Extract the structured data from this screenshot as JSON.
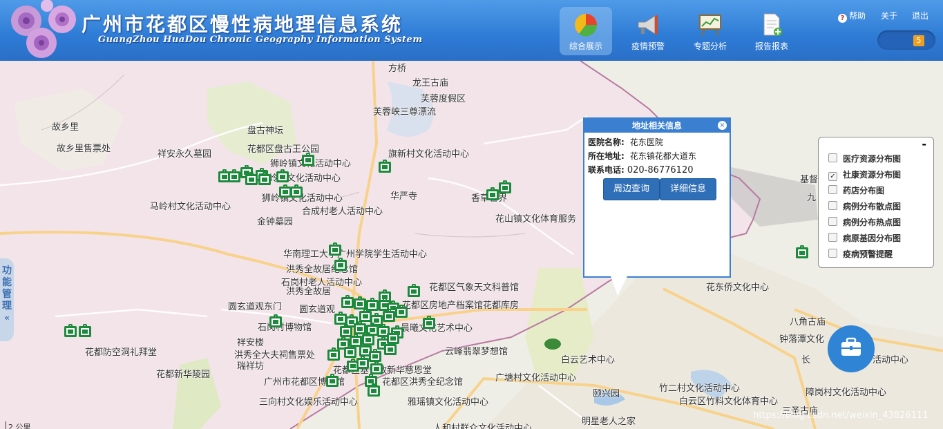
{
  "header": {
    "title_cn": "广州市花都区慢性病地理信息系统",
    "title_en": "GuangZhou HuaDou Chronic Geography Information System",
    "nav": [
      {
        "label": "综合展示",
        "icon": "pie-chart-icon"
      },
      {
        "label": "疫情预警",
        "icon": "megaphone-icon"
      },
      {
        "label": "专题分析",
        "icon": "easel-chart-icon"
      },
      {
        "label": "报告报表",
        "icon": "document-add-icon"
      }
    ],
    "links": {
      "help": "帮助",
      "about": "关于",
      "logout": "退出"
    },
    "message_count": "5"
  },
  "side_tab": {
    "label": "功能管理",
    "arrow": "«"
  },
  "map_labels": [
    "方桥",
    "龙王古庙",
    "芙蓉度假区",
    "芙蓉峡三尊漂流",
    "故乡里",
    "盘古神坛",
    "故乡里售票处",
    "祥安永久墓园",
    "花都区盘古王公园",
    "狮岭镇文化活动中心",
    "狮岭镇文化活动中心",
    "旗新村文化活动中心",
    "马岭村文化活动中心",
    "狮岭镇文化活动中心",
    "华严寺",
    "合成村老人活动中心",
    "香草世界",
    "金钟墓园",
    "花山镇文化体育服务",
    "华南理工大学广州学院学生活动中心",
    "洪秀全故居纪念馆",
    "石岗村老人活动中心",
    "洪秀全故居",
    "花都区气象天文科普馆",
    "圆玄道观东门",
    "圆玄道观",
    "花都区房地产档案馆花都库房",
    "石岗村博物馆",
    "晨曦文化艺术中心",
    "花东侨文化中心",
    "花都防空洞礼拜堂",
    "祥安楼",
    "洪秀全大夫祠售票处",
    "瑞祥坊",
    "云峰翡翠梦想馆",
    "八角古庙",
    "钟落潭文化",
    "白云艺术中心",
    "花都区基督教新华慈恩堂",
    "花都新华陵园",
    "广州市花都区博物馆",
    "花都区洪秀全纪念馆",
    "广塘村文化活动中心",
    "竹二村文化活动中心",
    "长",
    "活动中心",
    "颐兴园",
    "白云区竹料文化体育中心",
    "障岗村文化活动中心",
    "三向村文化娱乐活动中心",
    "雅瑶镇文化活动中心",
    "三圣古庙",
    "明星老人之家",
    "人和村群众文化活动中心",
    "基督",
    "九"
  ],
  "popup": {
    "title": "地址相关信息",
    "name_label": "医院名称:",
    "name_value": "花东医院",
    "addr_label": "所在地址:",
    "addr_value": "花东镇花都大道东",
    "phone_label": "联系电话:",
    "phone_value": "020-86776120",
    "btn_nearby": "周边查询",
    "btn_detail": "详细信息",
    "close": "×"
  },
  "layers": {
    "minimize": "-",
    "items": [
      {
        "label": "医疗资源分布图",
        "checked": false
      },
      {
        "label": "社康资源分布图",
        "checked": true
      },
      {
        "label": "药店分布图",
        "checked": false
      },
      {
        "label": "病例分布散点图",
        "checked": false
      },
      {
        "label": "病例分布热点图",
        "checked": false
      },
      {
        "label": "病原基因分布图",
        "checked": false
      },
      {
        "label": "疫病预警提醒",
        "checked": false
      }
    ]
  },
  "scale_text": "2 公里",
  "watermark": "https://blog.csdn.net/weixin_43826111",
  "colors": {
    "header": "#2e7bd6",
    "marker": "#1b8a3a",
    "district": "#f3e4ea",
    "accent": "#3a7fd0"
  }
}
